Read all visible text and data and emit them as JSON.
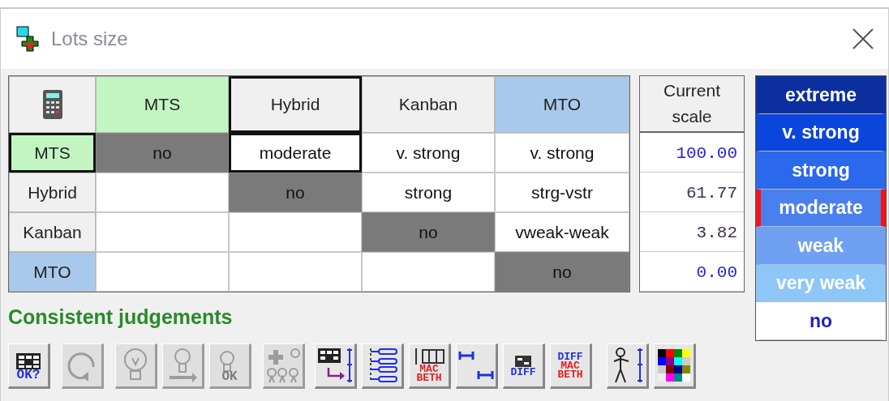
{
  "window": {
    "title": "Lots size"
  },
  "matrix": {
    "columns": [
      {
        "label": "MTS",
        "color": "#c2f5c2",
        "selected": false
      },
      {
        "label": "Hybrid",
        "color": "#f0f0f0",
        "selected": true
      },
      {
        "label": "Kanban",
        "color": "#f0f0f0",
        "selected": false
      },
      {
        "label": "MTO",
        "color": "#a9c9ec",
        "selected": false
      }
    ],
    "rows": [
      {
        "label": "MTS",
        "color": "#c2f5c2",
        "selected": true,
        "cells": [
          {
            "kind": "diagonal",
            "text": "no",
            "selected": false
          },
          {
            "kind": "value",
            "text": "moderate",
            "selected": true
          },
          {
            "kind": "value",
            "text": "v. strong",
            "selected": false
          },
          {
            "kind": "value",
            "text": "v. strong",
            "selected": false
          }
        ]
      },
      {
        "label": "Hybrid",
        "color": "#f0f0f0",
        "selected": false,
        "cells": [
          {
            "kind": "empty",
            "selected": false
          },
          {
            "kind": "diagonal",
            "text": "no",
            "selected": false
          },
          {
            "kind": "value",
            "text": "strong",
            "selected": false
          },
          {
            "kind": "value",
            "text": "strg-vstr",
            "selected": false
          }
        ]
      },
      {
        "label": "Kanban",
        "color": "#f0f0f0",
        "selected": false,
        "cells": [
          {
            "kind": "empty",
            "selected": false
          },
          {
            "kind": "empty",
            "selected": false
          },
          {
            "kind": "diagonal",
            "text": "no",
            "selected": false
          },
          {
            "kind": "value",
            "text": "vweak-weak",
            "selected": false
          }
        ]
      },
      {
        "label": "MTO",
        "color": "#a9c9ec",
        "selected": false,
        "cells": [
          {
            "kind": "empty",
            "selected": false
          },
          {
            "kind": "empty",
            "selected": false
          },
          {
            "kind": "empty",
            "selected": false
          },
          {
            "kind": "diagonal",
            "text": "no",
            "selected": false
          }
        ]
      }
    ]
  },
  "current_scale": {
    "heading": "Current scale",
    "values": [
      {
        "text": "100.00",
        "color": "#2020e0"
      },
      {
        "text": "61.77",
        "color": "#403050"
      },
      {
        "text": "3.82",
        "color": "#403050"
      },
      {
        "text": "0.00",
        "color": "#2020e0"
      }
    ]
  },
  "scale": [
    {
      "label": "extreme",
      "color": "#0c2fa0",
      "selected": false
    },
    {
      "label": "v. strong",
      "color": "#0a45dc",
      "selected": false
    },
    {
      "label": "strong",
      "color": "#2a68ec",
      "selected": false
    },
    {
      "label": "moderate",
      "color": "#4a80ee",
      "selected": true
    },
    {
      "label": "weak",
      "color": "#6fa0f2",
      "selected": false
    },
    {
      "label": "very weak",
      "color": "#8ec6f8",
      "selected": false
    },
    {
      "label": "no",
      "color": "#ffffff",
      "selected": false
    }
  ],
  "status": "Consistent judgements",
  "toolbar": [
    {
      "kind": "grid-check",
      "label": "OK?",
      "disabled": false
    },
    {
      "kind": "refresh",
      "disabled": true
    },
    {
      "kind": "bulb",
      "disabled": true
    },
    {
      "kind": "bulb-arrow",
      "disabled": true
    },
    {
      "kind": "bulb-ok",
      "label": "OK",
      "disabled": true
    },
    {
      "kind": "bulbs-plus",
      "disabled": true
    },
    {
      "kind": "grid-arrow",
      "disabled": false
    },
    {
      "kind": "list",
      "disabled": false
    },
    {
      "kind": "macbeth",
      "label": "MAC BETH",
      "disabled": false
    },
    {
      "kind": "arrows",
      "disabled": false
    },
    {
      "kind": "diff",
      "label": "DIFF",
      "disabled": false
    },
    {
      "kind": "diff-macbeth",
      "label": "DIFF MAC BETH",
      "disabled": false
    },
    {
      "kind": "figure",
      "disabled": false
    },
    {
      "kind": "palette",
      "disabled": false
    }
  ]
}
